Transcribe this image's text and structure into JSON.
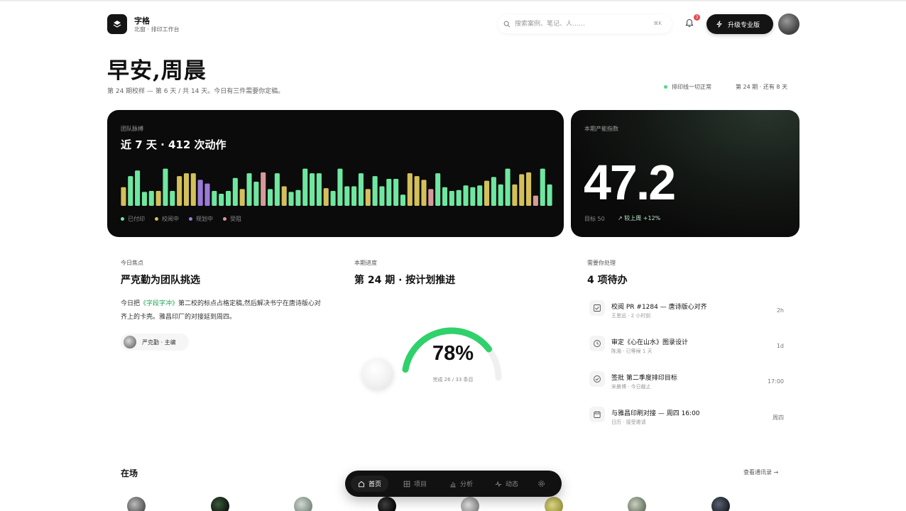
{
  "brand": {
    "name": "字格",
    "subtitle": "北窗 · 排印工作台"
  },
  "search": {
    "placeholder": "搜索案例、笔记、人……",
    "shortcut": "⌘K"
  },
  "notifications": {
    "count": "3"
  },
  "upgrade": {
    "label": "升级专业版"
  },
  "greeting": {
    "title": "早安,周晨",
    "subtitle": "第 24 期校样 — 第 6 天 / 共 14 天。今日有三件需要你定稿。"
  },
  "status": {
    "system": "排印线一切正常",
    "issue": "第 24 期 · 还有 8 天"
  },
  "pulse": {
    "label": "团队脉搏",
    "title": "近 7 天 · 412 次动作",
    "legend": [
      {
        "label": "已付印",
        "color": "#6ee7a0"
      },
      {
        "label": "校阅中",
        "color": "#d4c05a"
      },
      {
        "label": "规划中",
        "color": "#9b7bd6"
      },
      {
        "label": "受阻",
        "color": "#d79a9a"
      }
    ]
  },
  "chart_data": {
    "type": "bar",
    "series": [
      {
        "name": "",
        "values": [
          20,
          32,
          38,
          15,
          16,
          16,
          40,
          16,
          32,
          35,
          35,
          28,
          24,
          16,
          13,
          16,
          30,
          18,
          35,
          26,
          36,
          18,
          35,
          21,
          15,
          17,
          40,
          35,
          35,
          19,
          16,
          40,
          21,
          21,
          35,
          18,
          32,
          21,
          29,
          29,
          12,
          35,
          32,
          28,
          18,
          35,
          20,
          16,
          17,
          22,
          20,
          22,
          27,
          31,
          23,
          40,
          23,
          34,
          36,
          11,
          40,
          23
        ],
        "statuses": [
          "Y",
          "G",
          "G",
          "G",
          "G",
          "Y",
          "G",
          "G",
          "Y",
          "Y",
          "Y",
          "P",
          "P",
          "G",
          "G",
          "G",
          "G",
          "Y",
          "G",
          "G",
          "R",
          "G",
          "G",
          "Y",
          "G",
          "G",
          "G",
          "G",
          "G",
          "Y",
          "G",
          "G",
          "G",
          "G",
          "G",
          "Y",
          "G",
          "G",
          "G",
          "G",
          "G",
          "Y",
          "Y",
          "Y",
          "R",
          "G",
          "G",
          "G",
          "G",
          "G",
          "G",
          "G",
          "Y",
          "G",
          "G",
          "G",
          "Y",
          "Y",
          "Y",
          "R",
          "G",
          "G"
        ]
      }
    ]
  },
  "score": {
    "label": "本期产能指数",
    "value": "47.2",
    "target": "目标 50",
    "trend": "↗ 较上周 +12%"
  },
  "focus": {
    "label": "今日焦点",
    "title": "严克勤为团队挑选",
    "body_pre": "今日把",
    "body_hl": "《字段字冲》",
    "body_post": "第二校的标点占格定稿,然后解决书宁在唐诗版心对齐上的卡壳。雅昌印厂的对接延到周四。",
    "owner": "严克勤 · 主编"
  },
  "progress": {
    "label": "本期进度",
    "title": "第 24 期 · 按计划推进",
    "percent_label": "78%",
    "percent": 78,
    "detail": "完成 26 / 33 条目"
  },
  "todos": {
    "label": "需要你处理",
    "title": "4 项待办",
    "items": [
      {
        "icon": "review-icon",
        "title": "校阅 PR #1284 — 唐诗版心对齐",
        "meta": "王思远 · 2 小时前",
        "time": "2h"
      },
      {
        "icon": "clock-icon",
        "title": "审定《心在山水》图录设计",
        "meta": "陈湘 · 已等候 1 天",
        "time": "1d"
      },
      {
        "icon": "check-circle-icon",
        "title": "签批 第二季度排印目标",
        "meta": "宋晨博 · 今日截止",
        "time": "17:00"
      },
      {
        "icon": "calendar-icon",
        "title": "与雅昌印刷对接 — 周四 16:00",
        "meta": "日历 · 接受邀请",
        "time": "周四"
      }
    ]
  },
  "present": {
    "title": "在场",
    "link": "查看通讯录 →"
  },
  "nav": {
    "home": "首页",
    "projects": "项目",
    "analytics": "分析",
    "activity": "动态"
  }
}
